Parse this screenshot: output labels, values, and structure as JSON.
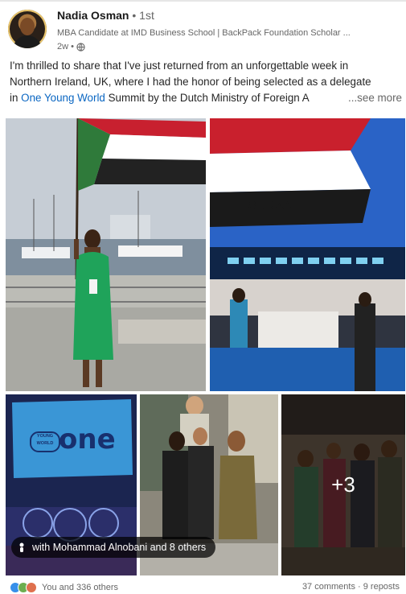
{
  "post": {
    "author_name": "Nadia Osman",
    "degree": " • 1st",
    "headline": "MBA Candidate at IMD Business School | BackPack Foundation Scholar ...",
    "time": "2w •",
    "text_line1": "I'm thrilled to share that I've just returned from an unforgettable week in",
    "text_line2": "Northern Ireland, UK, where I had the honor of being selected as a delegate",
    "text_line3_pre": "in ",
    "text_link": "One Young World",
    "text_line3_post": " Summit by the Dutch Ministry of Foreign A",
    "see_more": "...see more",
    "photo_text_sudan": "SUDAN",
    "photo_text_one": "one",
    "photo_text_young_world": "YOUNG WORLD",
    "tag_label": "with Mohammad Alnobani and 8 others",
    "more_photos": "+3",
    "reactions_text": "You and 336 others",
    "counts_text": "37 comments · 9 reposts",
    "icons": {
      "globe": "globe-icon",
      "tag": "person-tag-icon",
      "like": "like-reaction-icon",
      "celebrate": "celebrate-reaction-icon",
      "love": "love-reaction-icon"
    },
    "colors": {
      "link": "#0a66c2",
      "like": "#378fe9",
      "celebrate": "#6dae4f",
      "love": "#df704d"
    }
  }
}
